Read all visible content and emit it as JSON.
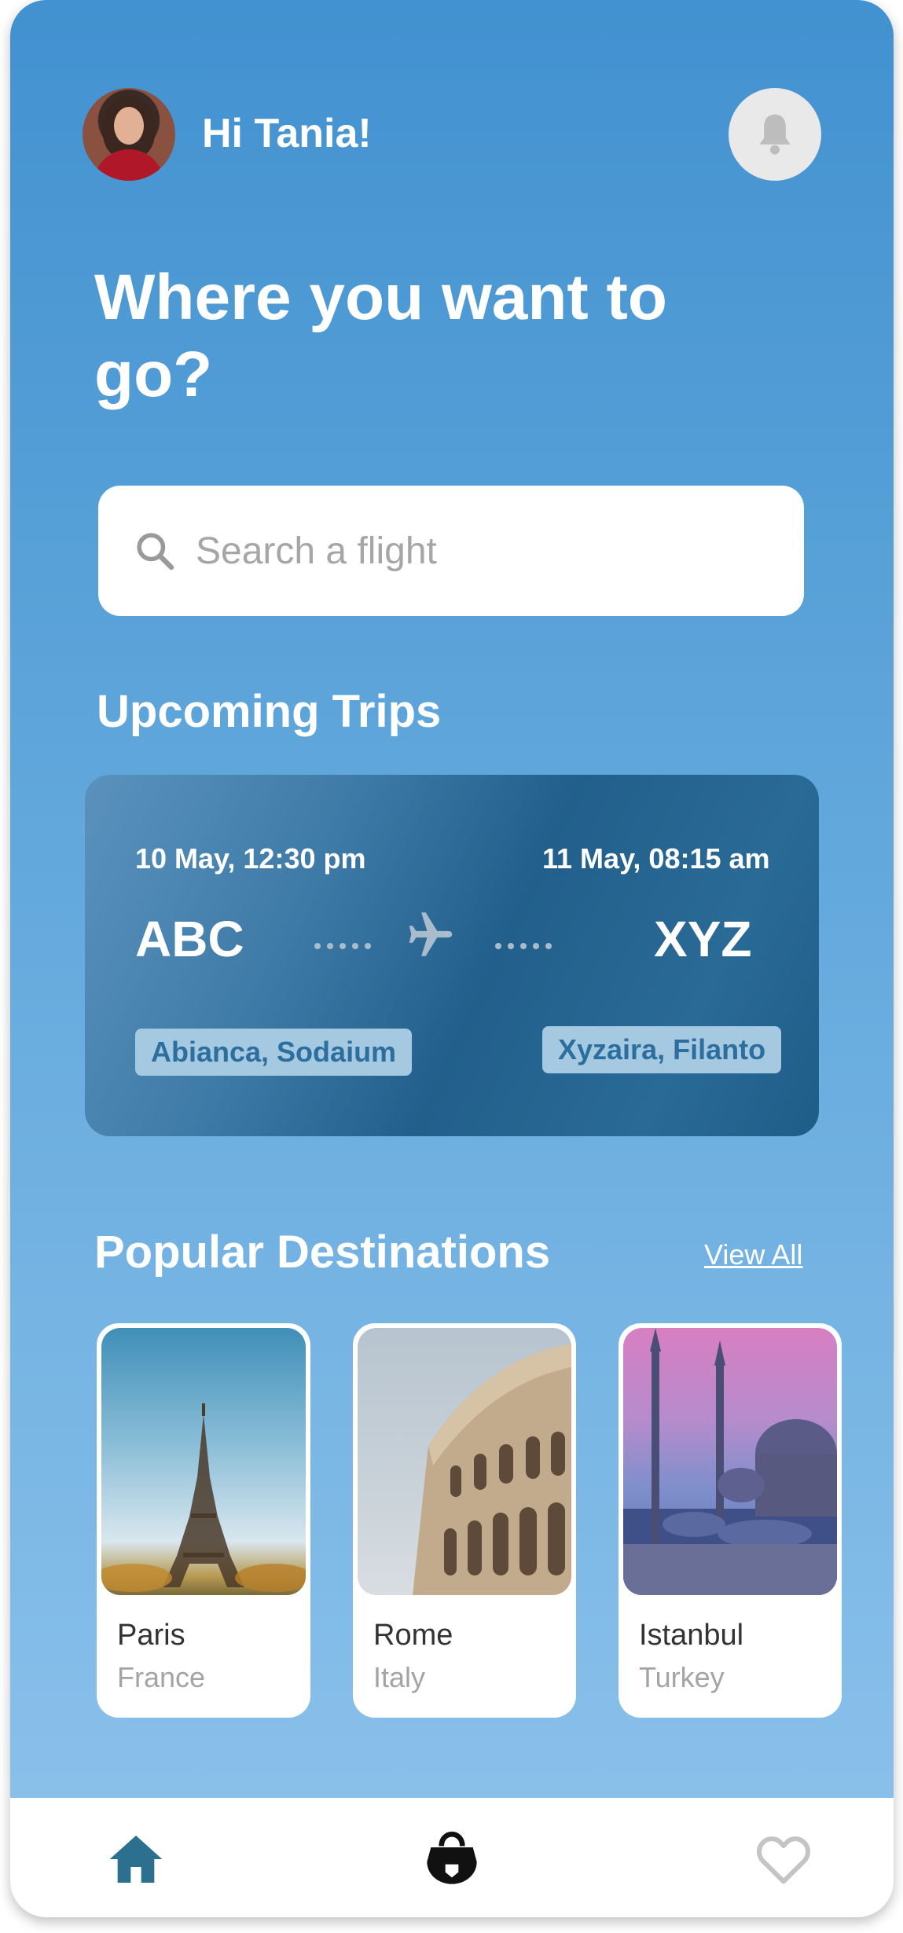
{
  "header": {
    "greeting": "Hi Tania!"
  },
  "headline": "Where you want to go?",
  "search": {
    "placeholder": "Search a flight",
    "value": ""
  },
  "upcoming": {
    "title": "Upcoming Trips",
    "trip": {
      "depart_time": "10 May, 12:30 pm",
      "arrive_time": "11 May, 08:15 am",
      "from_code": "ABC",
      "to_code": "XYZ",
      "from_place": "Abianca, Sodaium",
      "to_place": "Xyzaira, Filanto"
    }
  },
  "popular": {
    "title": "Popular Destinations",
    "view_all": "View All",
    "items": [
      {
        "city": "Paris",
        "country": "France"
      },
      {
        "city": "Rome",
        "country": "Italy"
      },
      {
        "city": "Istanbul",
        "country": "Turkey"
      }
    ]
  },
  "nav": {
    "icons": [
      "home-icon",
      "bag-icon",
      "heart-icon"
    ]
  },
  "colors": {
    "accent": "#2d6f8f",
    "card": "#225f8c",
    "background_top": "#4291d0",
    "background_bottom": "#8ec3ec"
  }
}
